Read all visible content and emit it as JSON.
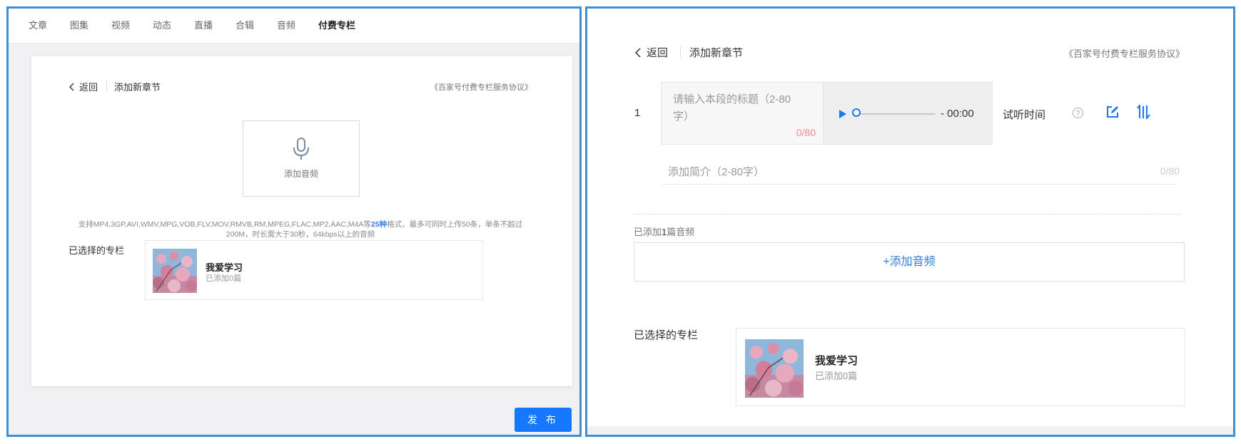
{
  "left": {
    "nav_tabs": [
      "文章",
      "图集",
      "视频",
      "动态",
      "直播",
      "合辑",
      "音频",
      "付费专栏"
    ],
    "active_tab": "付费专栏",
    "back_label": "返回",
    "page_title": "添加新章节",
    "agreement": "《百家号付费专栏服务协议》",
    "upload_label": "添加音频",
    "support_pre": "支持MP4,3GP,AVI,WMV,MPG,VOB,FLV,MOV,RMVB,RM,MPEG,FLAC,MP2,AAC,M4A等",
    "support_hl": "25种",
    "support_post": "格式，最多可同时上传50条，单条不超过200M，时长需大于30秒，64kbps以上的音频",
    "selected_label": "已选择的专栏",
    "column_name": "我爱学习",
    "column_count": "已添加0篇",
    "publish_label": "发 布"
  },
  "right": {
    "back_label": "返回",
    "page_title": "添加新章节",
    "agreement": "《百家号付费专栏服务协议》",
    "row_number": "1",
    "title_placeholder": "请输入本段的标题（2-80字）",
    "title_count": "0/80",
    "player_time": "- 00:00",
    "trial_label": "试听时间",
    "help_symbol": "?",
    "intro_placeholder": "添加简介（2-80字）",
    "intro_count": "0/80",
    "added_pre": "已添加",
    "added_num": "1",
    "added_post": "篇音频",
    "add_audio_label": "+添加音频",
    "selected_label": "已选择的专栏",
    "column_name": "我爱学习",
    "column_count": "已添加0篇"
  },
  "colors": {
    "frame": "#3f8fd2",
    "primary": "#1677ff",
    "link": "#2f7ed8",
    "counter_warn": "#f08a8a"
  },
  "icons": [
    "chevron-left-icon",
    "microphone-icon",
    "play-icon",
    "help-icon",
    "edit-icon",
    "sort-icon"
  ]
}
